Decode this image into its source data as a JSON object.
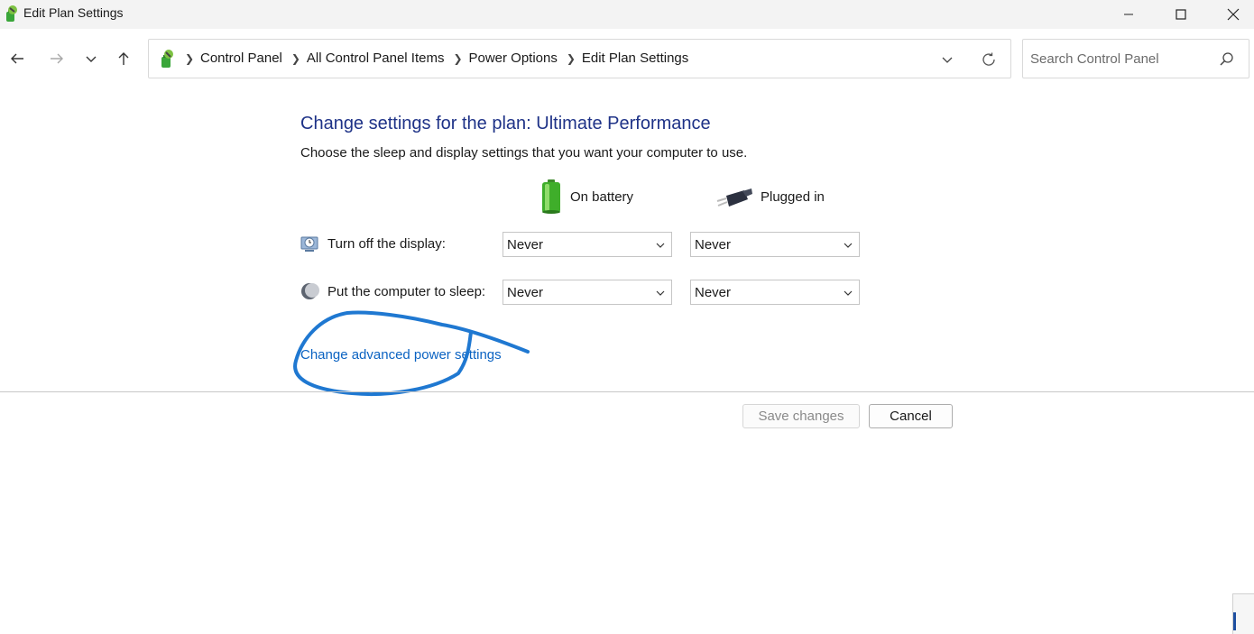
{
  "window": {
    "title": "Edit Plan Settings",
    "controls": {
      "minimize": "minimize",
      "maximize": "maximize",
      "close": "close"
    }
  },
  "nav": {
    "breadcrumbs": [
      "Control Panel",
      "All Control Panel Items",
      "Power Options",
      "Edit Plan Settings"
    ],
    "search_placeholder": "Search Control Panel"
  },
  "content": {
    "heading": "Change settings for the plan: Ultimate Performance",
    "subtext": "Choose the sleep and display settings that you want your computer to use.",
    "columns": {
      "battery": "On battery",
      "plugged": "Plugged in"
    },
    "rows": [
      {
        "label": "Turn off the display:",
        "on_battery": "Never",
        "plugged_in": "Never"
      },
      {
        "label": "Put the computer to sleep:",
        "on_battery": "Never",
        "plugged_in": "Never"
      }
    ],
    "advanced_link": "Change advanced power settings"
  },
  "buttons": {
    "save": "Save changes",
    "cancel": "Cancel"
  },
  "colors": {
    "heading": "#1e3287",
    "link": "#0b63c2",
    "annotation": "#1f78d1"
  },
  "icons": [
    "power-options-icon",
    "back-arrow-icon",
    "forward-arrow-icon",
    "chevron-down-icon",
    "up-arrow-icon",
    "refresh-icon",
    "search-icon",
    "battery-icon",
    "plug-icon",
    "display-icon",
    "sleep-moon-icon"
  ]
}
